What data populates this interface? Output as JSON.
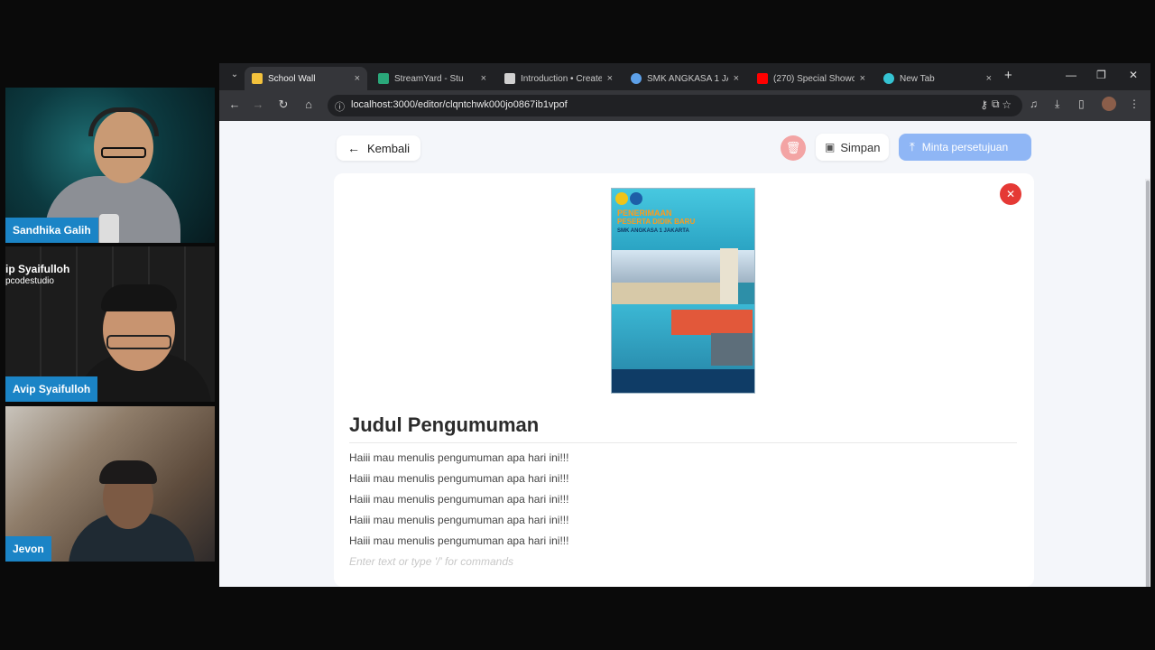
{
  "participants": [
    {
      "name": "Sandhika Galih"
    },
    {
      "name": "Avip Syaifulloh",
      "overlay_name": "ip Syaifulloh",
      "overlay_sub": "pcodestudio"
    },
    {
      "name": "Jevon"
    }
  ],
  "browser": {
    "tabs": [
      {
        "label": "School Wall",
        "close": "×",
        "icon_color": "#f3c23c",
        "active": true
      },
      {
        "label": "StreamYard - Stu",
        "close": "×",
        "icon_color": "#2aa87a",
        "active": false
      },
      {
        "label": "Introduction • Create",
        "close": "×",
        "icon_color": "#d0d0d0",
        "active": false
      },
      {
        "label": "SMK ANGKASA 1 JA",
        "close": "×",
        "icon_color": "#5da0e8",
        "active": false
      },
      {
        "label": "(270) Special Showc",
        "close": "×",
        "icon_color": "#ff0000",
        "active": false
      },
      {
        "label": "New Tab",
        "close": "×",
        "icon_color": "#35c3d2",
        "active": false
      }
    ],
    "new_tab": "+",
    "window_buttons": {
      "minimize": "—",
      "restore": "❐",
      "close": "✕"
    },
    "url": "localhost:3000/editor/clqntchwk000jo0867ib1vpof"
  },
  "editor": {
    "back_label": "Kembali",
    "save_label": "Simpan",
    "publish_label": "Minta persetujuan",
    "delete_icon": "trash-icon",
    "remove_image_icon": "close-icon",
    "title": "Judul Pengumuman",
    "paragraphs": [
      "Haiii mau menulis pengumuman apa hari ini!!!",
      "Haiii mau menulis pengumuman apa hari ini!!!",
      "Haiii mau menulis pengumuman apa hari ini!!!",
      "Haiii mau menulis pengumuman apa hari ini!!!",
      "Haiii mau menulis pengumuman apa hari ini!!!"
    ],
    "placeholder": "Enter text or type '/' for commands",
    "poster": {
      "title_line1": "PENERIMAAN",
      "title_line2": "PESERTA DIDIK BARU",
      "subtitle": "SMK ANGKASA 1 JAKARTA"
    }
  },
  "colors": {
    "accent": "#1b84c6",
    "publish": "#8fb6f5",
    "danger": "#e53935"
  }
}
